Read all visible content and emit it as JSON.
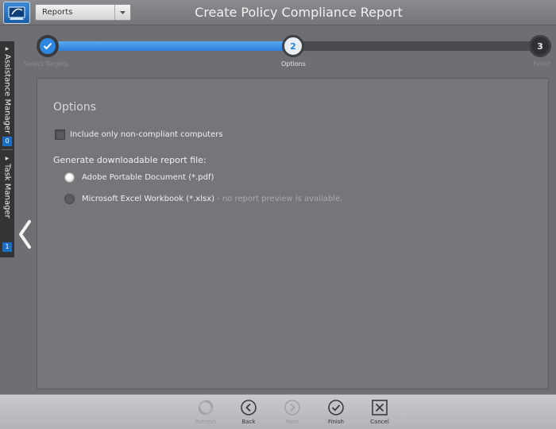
{
  "header": {
    "dropdown_value": "Reports",
    "title": "Create Policy Compliance Report"
  },
  "left_rail": {
    "assistance_manager": {
      "label": "Assistance Manager",
      "count": "0"
    },
    "task_manager": {
      "label": "Task Manager",
      "count": "1"
    }
  },
  "stepper": {
    "current_step": 2,
    "steps": [
      {
        "number": "",
        "label": "Select Targets",
        "state": "complete"
      },
      {
        "number": "2",
        "label": "Options",
        "state": "current"
      },
      {
        "number": "3",
        "label": "Finish",
        "state": "pending"
      }
    ]
  },
  "options": {
    "section_title": "Options",
    "non_compliant_label": "Include only non-compliant computers",
    "non_compliant_checked": false,
    "generate_label": "Generate downloadable report file:",
    "formats": [
      {
        "label": "Adobe Portable Document (*.pdf)",
        "selected": true,
        "hint": ""
      },
      {
        "label": "Microsoft Excel Workbook (*.xlsx)",
        "selected": false,
        "hint": "- no report preview is available."
      }
    ]
  },
  "toolbar": {
    "refresh": "Refresh",
    "back": "Back",
    "next": "Next",
    "finish": "Finish",
    "cancel": "Cancel"
  },
  "colors": {
    "accent": "#2d87e0",
    "background": "#6e6f73",
    "panel": "#75767a",
    "toolbar": "#c0c1c4"
  }
}
